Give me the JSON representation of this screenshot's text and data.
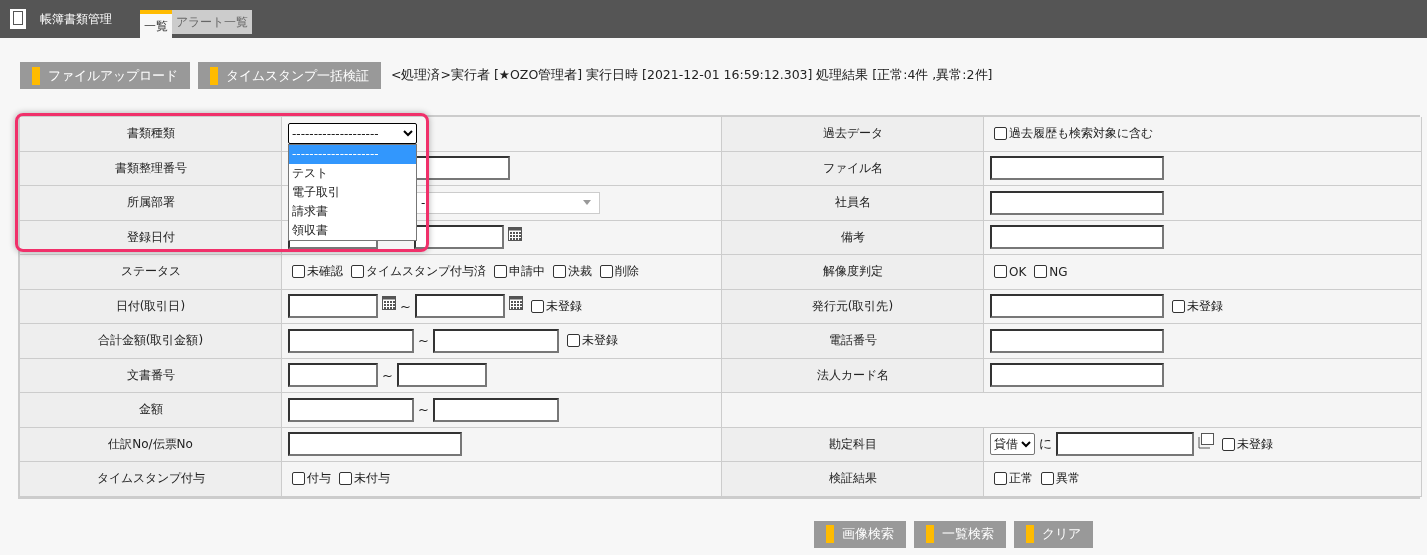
{
  "app": {
    "title": "帳簿書類管理"
  },
  "tabs": [
    {
      "label": "一覧",
      "selected": true
    },
    {
      "label": "アラート一覧",
      "selected": false
    }
  ],
  "toolbar": {
    "buttons": [
      "ファイルアップロード",
      "タイムスタンプ一括検証"
    ],
    "status": "<処理済>実行者 [★OZO管理者] 実行日時 [2021-12-01 16:59:12.303] 処理結果 [正常:4件 ,異常:2件]"
  },
  "highlight_frame": true,
  "form_rows": [
    {
      "left": {
        "label": "書類種類",
        "controls": [
          {
            "kind": "select",
            "value": "--------------------",
            "expanded": true,
            "options": [
              {
                "label": "--------------------",
                "selected": true
              },
              {
                "label": "テスト",
                "selected": false
              },
              {
                "label": "電子取引",
                "selected": false
              },
              {
                "label": "請求書",
                "selected": false
              },
              {
                "label": "領収書",
                "selected": false
              }
            ]
          }
        ]
      },
      "right": {
        "label": "過去データ",
        "controls": [
          {
            "kind": "checkbox",
            "label": "過去履歴も検索対象に含む",
            "checked": false
          }
        ]
      }
    },
    {
      "left": {
        "label": "書類整理番号",
        "controls": [
          {
            "kind": "wide-field"
          }
        ]
      },
      "right": {
        "label": "ファイル名",
        "controls": [
          {
            "kind": "text-field"
          }
        ]
      }
    },
    {
      "left": {
        "label": "所属部署",
        "controls": [
          {
            "kind": "combo",
            "value": "-"
          }
        ]
      },
      "right": {
        "label": "社員名",
        "controls": [
          {
            "kind": "text-field"
          }
        ]
      }
    },
    {
      "left": {
        "label": "登録日付",
        "controls": [
          {
            "kind": "covered-date-field"
          },
          {
            "kind": "gap"
          },
          {
            "kind": "date-field"
          }
        ]
      },
      "right": {
        "label": "備考",
        "controls": [
          {
            "kind": "text-field"
          }
        ]
      }
    },
    {
      "left": {
        "label": "ステータス",
        "controls": [
          {
            "kind": "checkbox",
            "label": "未確認",
            "checked": false
          },
          {
            "kind": "checkbox",
            "label": "タイムスタンプ付与済",
            "checked": false
          },
          {
            "kind": "checkbox",
            "label": "申請中",
            "checked": false
          },
          {
            "kind": "checkbox",
            "label": "決裁",
            "checked": false
          },
          {
            "kind": "checkbox",
            "label": "削除",
            "checked": false
          }
        ]
      },
      "right": {
        "label": "解像度判定",
        "controls": [
          {
            "kind": "checkbox",
            "label": "OK",
            "checked": false
          },
          {
            "kind": "checkbox",
            "label": "NG",
            "checked": false
          }
        ]
      }
    },
    {
      "left": {
        "label": "日付(取引日)",
        "controls": [
          {
            "kind": "date-field"
          },
          {
            "kind": "tilde",
            "text": "~"
          },
          {
            "kind": "date-field"
          },
          {
            "kind": "checkbox",
            "label": "未登録",
            "checked": false
          }
        ]
      },
      "right": {
        "label": "発行元(取引先)",
        "controls": [
          {
            "kind": "text-field"
          },
          {
            "kind": "checkbox",
            "label": "未登録",
            "checked": false
          }
        ]
      }
    },
    {
      "left": {
        "label": "合計金額(取引金額)",
        "controls": [
          {
            "kind": "amount-field"
          },
          {
            "kind": "tilde",
            "text": "~"
          },
          {
            "kind": "amount-field"
          },
          {
            "kind": "checkbox",
            "label": "未登録",
            "checked": false
          }
        ]
      },
      "right": {
        "label": "電話番号",
        "controls": [
          {
            "kind": "text-field"
          }
        ]
      }
    },
    {
      "left": {
        "label": "文書番号",
        "controls": [
          {
            "kind": "code-field"
          },
          {
            "kind": "tilde",
            "text": "~"
          },
          {
            "kind": "code-field"
          }
        ]
      },
      "right": {
        "label": "法人カード名",
        "controls": [
          {
            "kind": "text-field"
          }
        ]
      }
    },
    {
      "left": {
        "label": "金額",
        "controls": [
          {
            "kind": "amount-field"
          },
          {
            "kind": "tilde",
            "text": "~"
          },
          {
            "kind": "amount-field"
          }
        ]
      },
      "right": null
    },
    {
      "left": {
        "label": "仕訳No/伝票No",
        "controls": [
          {
            "kind": "text-field"
          }
        ]
      },
      "right": {
        "label": "勘定科目",
        "controls": [
          {
            "kind": "small-select",
            "value": "貸借"
          },
          {
            "kind": "word",
            "text": "に"
          },
          {
            "kind": "account-field"
          },
          {
            "kind": "copy-icon"
          },
          {
            "kind": "checkbox",
            "label": "未登録",
            "checked": false
          }
        ]
      }
    },
    {
      "left": {
        "label": "タイムスタンプ付与",
        "controls": [
          {
            "kind": "checkbox",
            "label": "付与",
            "checked": false
          },
          {
            "kind": "checkbox",
            "label": "未付与",
            "checked": false
          }
        ]
      },
      "right": {
        "label": "検証結果",
        "controls": [
          {
            "kind": "checkbox",
            "label": "正常",
            "checked": false
          },
          {
            "kind": "checkbox",
            "label": "異常",
            "checked": false
          }
        ]
      }
    }
  ],
  "search_buttons": [
    "画像検索",
    "一覧検索",
    "クリア"
  ]
}
